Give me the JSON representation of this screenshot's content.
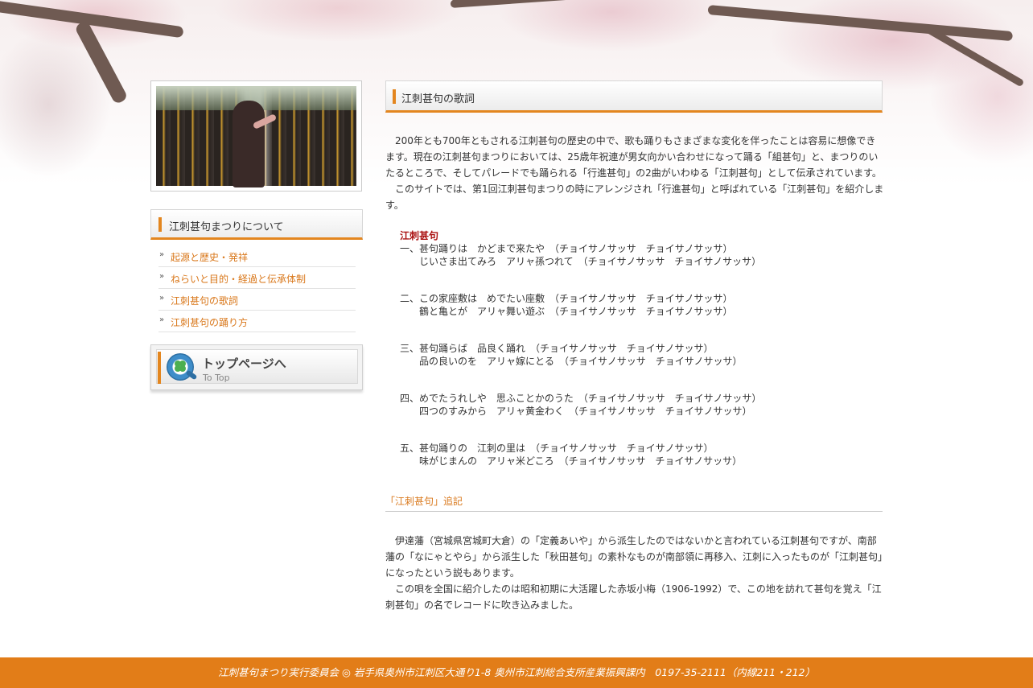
{
  "sidebar": {
    "photo_alt": "踊りの写真",
    "heading": "江刺甚句まつりについて",
    "menu": [
      {
        "label": "起源と歴史・発祥"
      },
      {
        "label": "ねらいと目的・経過と伝承体制"
      },
      {
        "label": "江刺甚句の歌詞"
      },
      {
        "label": "江刺甚句の踊り方"
      }
    ],
    "menu_chevron": "»",
    "top_button": {
      "title": "トップページへ",
      "subtitle": "To Top",
      "icon": "q-clover-icon"
    }
  },
  "main": {
    "heading": "江刺甚句の歌詞",
    "intro": [
      "200年とも700年ともされる江刺甚句の歴史の中で、歌も踊りもさまざまな変化を伴ったことは容易に想像できます。現在の江刺甚句まつりにおいては、25歳年祝連が男女向かい合わせになって踊る「組甚句」と、まつりのいたるところで、そしてパレードでも踊られる「行進甚句」の2曲がいわゆる「江刺甚句」として伝承されています。",
      "このサイトでは、第1回江刺甚句まつりの時にアレンジされ「行進甚句」と呼ばれている「江刺甚句」を紹介します。"
    ],
    "lyrics": {
      "title": "江刺甚句",
      "verses": [
        {
          "line1": "一、甚句踊りは　かどまで来たや　（チョイサノサッサ　チョイサノサッサ）",
          "line2": "じいさま出てみろ　アリャ孫つれて　（チョイサノサッサ　チョイサノサッサ）"
        },
        {
          "line1": "二、この家座敷は　めでたい座敷　（チョイサノサッサ　チョイサノサッサ）",
          "line2": "鶴と亀とが　アリャ舞い遊ぶ　（チョイサノサッサ　チョイサノサッサ）"
        },
        {
          "line1": "三、甚句踊らば　品良く踊れ　（チョイサノサッサ　チョイサノサッサ）",
          "line2": "品の良いのを　アリャ嫁にとる　（チョイサノサッサ　チョイサノサッサ）"
        },
        {
          "line1": "四、めでたうれしや　思ふことかのうた　（チョイサノサッサ　チョイサノサッサ）",
          "line2": "四つのすみから　アリャ黄金わく　（チョイサノサッサ　チョイサノサッサ）"
        },
        {
          "line1": "五、甚句踊りの　江刺の里は　（チョイサノサッサ　チョイサノサッサ）",
          "line2": "味がじまんの　アリャ米どころ　（チョイサノサッサ　チョイサノサッサ）"
        }
      ]
    },
    "postscript_heading": "「江刺甚句」追記",
    "postscript": [
      "伊達藩（宮城県宮城町大倉）の「定義あいや」から派生したのではないかと言われている江刺甚句ですが、南部藩の「なにゃとやら」から派生した「秋田甚句」の素朴なものが南部領に再移入、江刺に入ったものが「江刺甚句」になったという説もあります。",
      "この唄を全国に紹介したのは昭和初期に大活躍した赤坂小梅（1906-1992）で、この地を訪れて甚句を覚え「江刺甚句」の名でレコードに吹き込みました。"
    ]
  },
  "footer": {
    "text": "江刺甚句まつり実行委員会 ◎ 岩手県奥州市江刺区大通り1-8 奥州市江刺総合支所産業振興課内　0197-35-2111（内線211・212）"
  },
  "colors": {
    "accent": "#e3861f",
    "link": "#d9771a",
    "lyrics_title": "#aa1111",
    "footer_bg": "#e27d18"
  }
}
